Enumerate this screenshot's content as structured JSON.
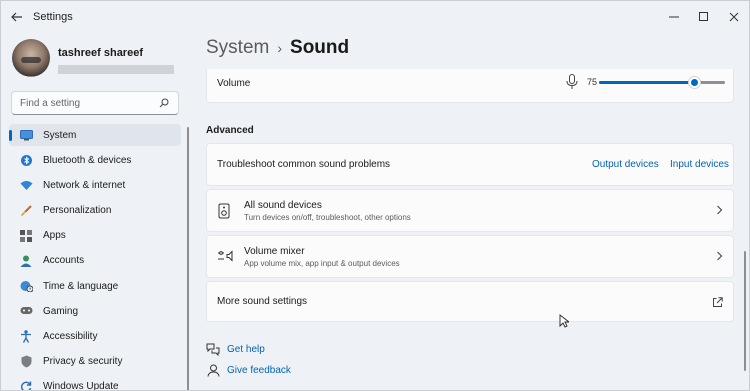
{
  "window": {
    "title": "Settings",
    "controls": {
      "minimize": "—",
      "maximize": "☐",
      "close": "✕"
    }
  },
  "profile": {
    "name": "tashreef shareef"
  },
  "search": {
    "placeholder": "Find a setting"
  },
  "sidebar": {
    "items": [
      {
        "label": "System",
        "icon": "monitor-icon",
        "active": true
      },
      {
        "label": "Bluetooth & devices",
        "icon": "bluetooth-icon"
      },
      {
        "label": "Network & internet",
        "icon": "wifi-icon"
      },
      {
        "label": "Personalization",
        "icon": "brush-icon"
      },
      {
        "label": "Apps",
        "icon": "apps-icon"
      },
      {
        "label": "Accounts",
        "icon": "person-icon"
      },
      {
        "label": "Time & language",
        "icon": "globe-clock-icon"
      },
      {
        "label": "Gaming",
        "icon": "gamepad-icon"
      },
      {
        "label": "Accessibility",
        "icon": "accessibility-icon"
      },
      {
        "label": "Privacy & security",
        "icon": "shield-icon"
      },
      {
        "label": "Windows Update",
        "icon": "update-icon"
      }
    ]
  },
  "breadcrumb": {
    "parent": "System",
    "separator": "›",
    "current": "Sound"
  },
  "volume": {
    "label": "Volume",
    "value": "75",
    "level": 0.75
  },
  "advanced": {
    "title": "Advanced",
    "troubleshoot": {
      "label": "Troubleshoot common sound problems",
      "link_output": "Output devices",
      "link_input": "Input devices"
    },
    "all_devices": {
      "title": "All sound devices",
      "subtitle": "Turn devices on/off, troubleshoot, other options"
    },
    "mixer": {
      "title": "Volume mixer",
      "subtitle": "App volume mix, app input & output devices"
    },
    "more": {
      "label": "More sound settings"
    }
  },
  "footer": {
    "help": "Get help",
    "feedback": "Give feedback"
  },
  "colors": {
    "accent": "#0067c0",
    "link": "#0563b0"
  }
}
